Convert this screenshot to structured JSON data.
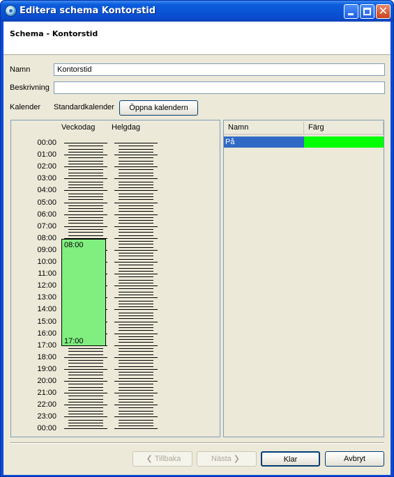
{
  "window": {
    "title": "Editera schema Kontorstid",
    "minimize_icon": "minimize-icon",
    "maximize_icon": "maximize-icon",
    "close_icon": "close-icon",
    "close_glyph": "✕"
  },
  "header": {
    "title": "Schema - Kontorstid"
  },
  "form": {
    "name_label": "Namn",
    "name_value": "Kontorstid",
    "description_label": "Beskrivning",
    "description_value": "",
    "calendar_label": "Kalender",
    "calendar_value": "Standardkalender",
    "open_calendar_button": "Öppna kalendern"
  },
  "schedule": {
    "columns": [
      "Veckodag",
      "Helgdag"
    ],
    "times": [
      "00:00",
      "01:00",
      "02:00",
      "03:00",
      "04:00",
      "05:00",
      "06:00",
      "07:00",
      "08:00",
      "09:00",
      "10:00",
      "11:00",
      "12:00",
      "13:00",
      "14:00",
      "15:00",
      "16:00",
      "17:00",
      "18:00",
      "19:00",
      "20:00",
      "21:00",
      "22:00",
      "23:00",
      "00:00"
    ],
    "block": {
      "column": "Veckodag",
      "start": "08:00",
      "end": "17:00",
      "color": "#80ef80"
    }
  },
  "color_table": {
    "headers": [
      "Namn",
      "Färg"
    ],
    "rows": [
      {
        "name": "På",
        "color": "#00ff00"
      }
    ],
    "selection_color": "#316ac5"
  },
  "footer": {
    "back_button": "Tillbaka",
    "next_button": "Nästa",
    "finish_button": "Klar",
    "cancel_button": "Avbryt"
  }
}
